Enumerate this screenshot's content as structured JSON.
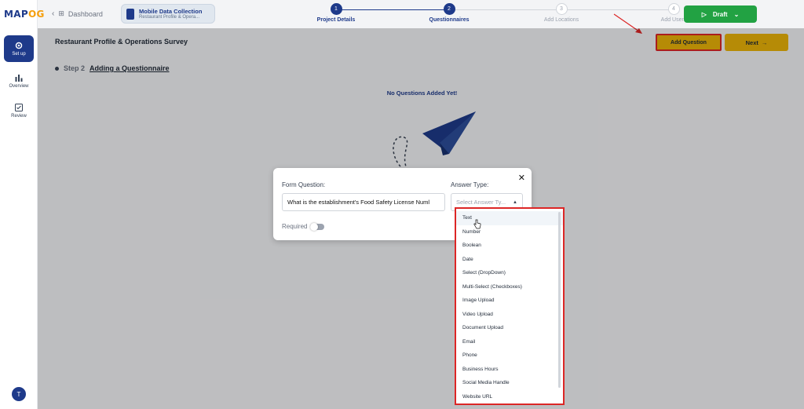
{
  "app": {
    "logo_main": "MAP",
    "logo_accent": "OG"
  },
  "rail": [
    {
      "label": "Set up",
      "icon": "gear-icon",
      "active": true
    },
    {
      "label": "Overview",
      "icon": "bar-chart-icon",
      "active": false
    },
    {
      "label": "Review",
      "icon": "checkbox-icon",
      "active": false
    }
  ],
  "rail_labels": {
    "setup": "Set up",
    "overview": "Overview",
    "review": "Review"
  },
  "user": {
    "initial": "T"
  },
  "topbar": {
    "back_label": "Dashboard",
    "project_title": "Mobile Data Collection",
    "project_sub": "Restaurant Profile & Opera...",
    "draft_label": "Draft"
  },
  "stepper": [
    {
      "num": "1",
      "label": "Project Details",
      "state": "done"
    },
    {
      "num": "2",
      "label": "Questionnaires",
      "state": "active"
    },
    {
      "num": "3",
      "label": "Add Locations",
      "state": "todo"
    },
    {
      "num": "4",
      "label": "Add Users",
      "state": "todo"
    }
  ],
  "page": {
    "title": "Restaurant Profile & Operations Survey",
    "add_question": "Add Question",
    "next": "Next",
    "step_num": "Step 2",
    "step_title": "Adding a Questionnaire",
    "empty_text": "No Questions Added Yet!"
  },
  "modal": {
    "question_label": "Form Question:",
    "question_value": "What is the establishment's Food Safety License Numl",
    "answer_label": "Answer Type:",
    "answer_placeholder": "Select Answer Ty...",
    "required_label": "Required"
  },
  "answer_types": [
    "Text",
    "Number",
    "Boolean",
    "Date",
    "Select (DropDown)",
    "Multi-Select (Checkboxes)",
    "Image Upload",
    "Video Upload",
    "Document Upload",
    "Email",
    "Phone",
    "Business Hours",
    "Social Media Handle",
    "Website URL"
  ],
  "colors": {
    "brand": "#1e3a8a",
    "accent": "#eab308",
    "draft": "#22a243",
    "highlight_box": "#dc2626"
  }
}
